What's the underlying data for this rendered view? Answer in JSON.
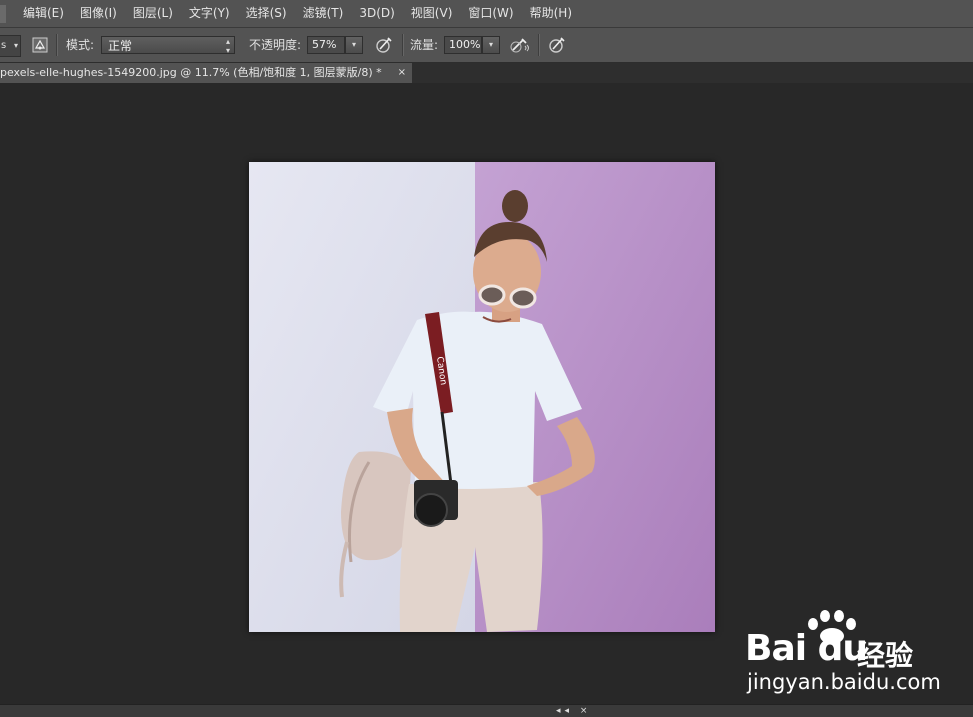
{
  "menubar": {
    "items": [
      "编辑(E)",
      "图像(I)",
      "图层(L)",
      "文字(Y)",
      "选择(S)",
      "滤镜(T)",
      "3D(D)",
      "视图(V)",
      "窗口(W)",
      "帮助(H)"
    ]
  },
  "options": {
    "preset_partial": "s",
    "mode_label": "模式:",
    "mode_value": "正常",
    "opacity_label": "不透明度:",
    "opacity_value": "57%",
    "flow_label": "流量:",
    "flow_value": "100%"
  },
  "document": {
    "tab_title": "pexels-elle-hughes-1549200.jpg @ 11.7% (色相/饱和度 1, 图层蒙版/8) *",
    "close_glyph": "×"
  },
  "photo": {
    "strap_text": "Canon",
    "colors": {
      "left_wall": "#dfe0ee",
      "right_wall": "#b98fc9",
      "shirt": "#eaf0f8",
      "pants": "#e2d4cc",
      "bag": "#d8c6bf"
    }
  },
  "bottom": {
    "controls": "◂◂ ×"
  },
  "watermark": {
    "logo": "Bai du",
    "cn": "经验",
    "url": "jingyan.baidu.com"
  }
}
